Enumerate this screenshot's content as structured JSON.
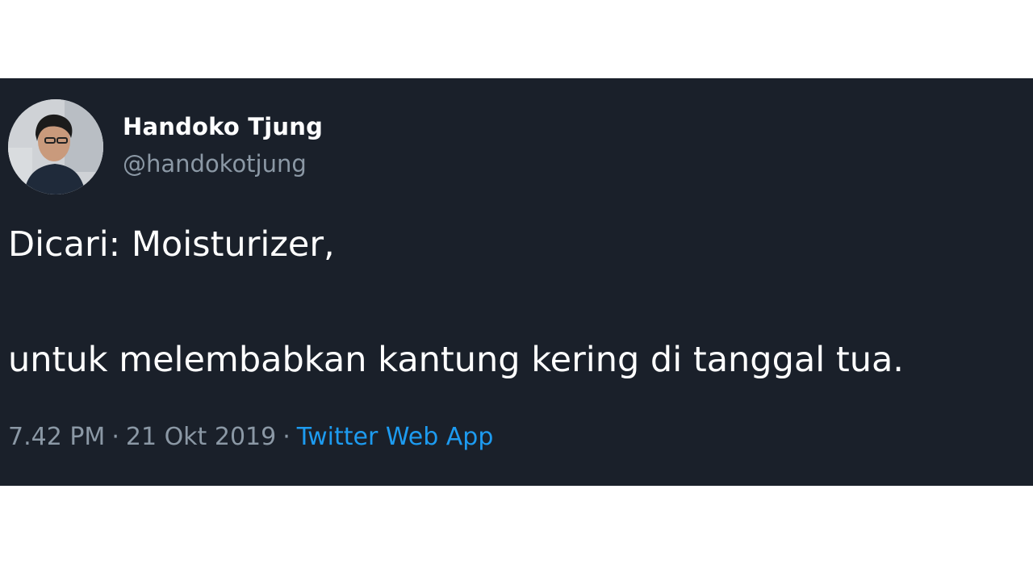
{
  "tweet": {
    "author": {
      "display_name": "Handoko Tjung",
      "handle": "@handokotjung",
      "avatar_icon": "profile-photo"
    },
    "text_lines": [
      "Dicari: Moisturizer,",
      "untuk melembabkan kantung kering di tanggal tua."
    ],
    "meta": {
      "time": "7.42 PM",
      "separator": "·",
      "date": "21 Okt 2019",
      "source": "Twitter Web App"
    },
    "colors": {
      "background": "#1a202a",
      "text": "#ffffff",
      "muted": "#8b98a5",
      "link": "#1d9bf0"
    }
  }
}
